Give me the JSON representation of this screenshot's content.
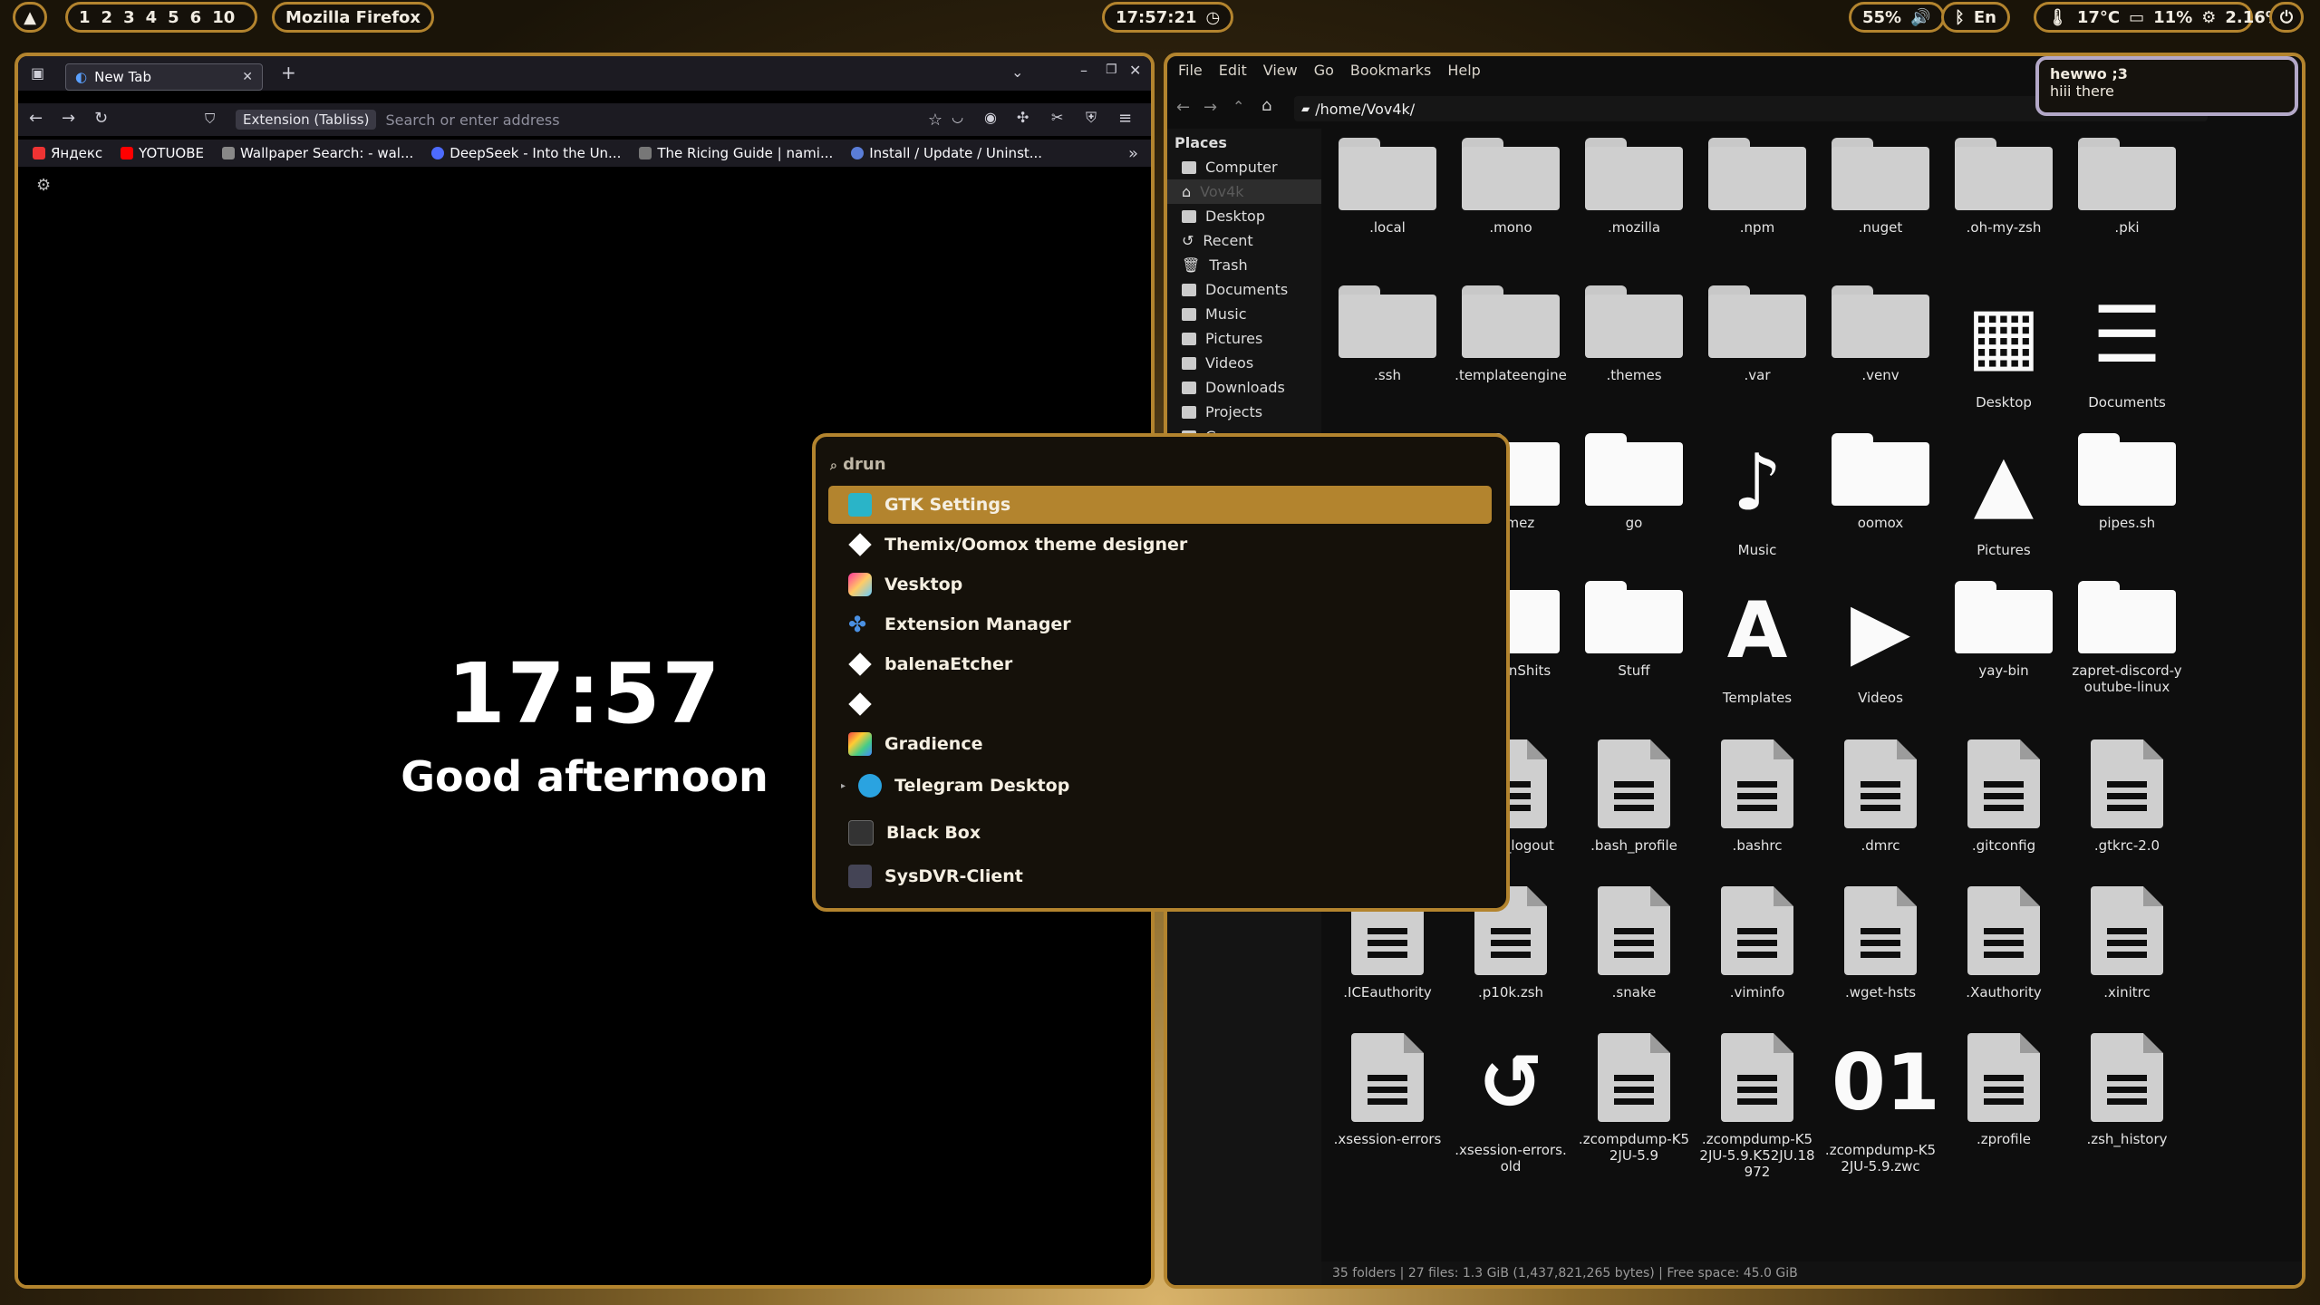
{
  "topbar": {
    "workspaces": [
      "1",
      "2",
      "3",
      "4",
      "5",
      "6",
      "10"
    ],
    "active_window": "Mozilla Firefox",
    "clock": "17:57:21",
    "volume": "55%",
    "keyboard_layout": "En",
    "temperature": "17°C",
    "battery": "11%",
    "cpu": "2.16%"
  },
  "firefox": {
    "tab_title": "New Tab",
    "extension_chip": "Extension (Tabliss)",
    "url_placeholder": "Search or enter address",
    "bookmarks": [
      "Яндекс",
      "YOTUOBE",
      "Wallpaper Search: - wal...",
      "DeepSeek - Into the Un...",
      "The Ricing Guide | nami...",
      "Install / Update / Uninst..."
    ],
    "clock": "17:57",
    "greeting": "Good afternoon"
  },
  "filemanager": {
    "menu": [
      "File",
      "Edit",
      "View",
      "Go",
      "Bookmarks",
      "Help"
    ],
    "path": "/home/Vov4k/",
    "places_title": "Places",
    "places": [
      "Computer",
      "Vov4k",
      "Desktop",
      "Recent",
      "Trash",
      "Documents",
      "Music",
      "Pictures",
      "Videos",
      "Downloads",
      "Projects",
      "Gamez"
    ],
    "status": "35 folders  |  27 files: 1.3 GiB (1,437,821,265 bytes)  |  Free space: 45.0 GiB",
    "row1": [
      ".local",
      ".mono",
      ".mozilla",
      ".npm",
      ".nuget",
      ".oh-my-zsh",
      ".pki"
    ],
    "row2": [
      ".ssh",
      ".templateengine",
      ".themes",
      ".var",
      ".venv",
      "Desktop",
      "Documents"
    ],
    "row3": [
      "Gamez",
      "go",
      "Music",
      "oomox",
      "Pictures",
      "pipes.sh"
    ],
    "row4": [
      "ScreenShits",
      "Stuff",
      "Templates",
      "Videos",
      "yay-bin",
      "zapret-discord-youtube-linux"
    ],
    "row5": [
      ".bash_logout",
      ".bash_profile",
      ".bashrc",
      ".dmrc",
      ".gitconfig",
      ".gtkrc-2.0"
    ],
    "row6": [
      ".ICEauthority",
      ".p10k.zsh",
      ".snake",
      ".viminfo",
      ".wget-hsts",
      ".Xauthority",
      ".xinitrc"
    ],
    "row7": [
      ".xsession-errors",
      ".xsession-errors.old",
      ".zcompdump-K52JU-5.9",
      ".zcompdump-K52JU-5.9.K52JU.18972",
      ".zcompdump-K52JU-5.9.zwc",
      ".zprofile",
      ".zsh_history"
    ]
  },
  "notification": {
    "title": "hewwo ;3",
    "body": "hiii there"
  },
  "launcher": {
    "query": "drun",
    "items": [
      "GTK Settings",
      "Themix/Oomox theme designer",
      "Vesktop",
      "Extension Manager",
      "balenaEtcher",
      "",
      "Gradience",
      "Telegram Desktop",
      "Black Box",
      "SysDVR-Client"
    ]
  },
  "colors": {
    "accent": "#b3842e",
    "panel_bg": "#15110a"
  }
}
